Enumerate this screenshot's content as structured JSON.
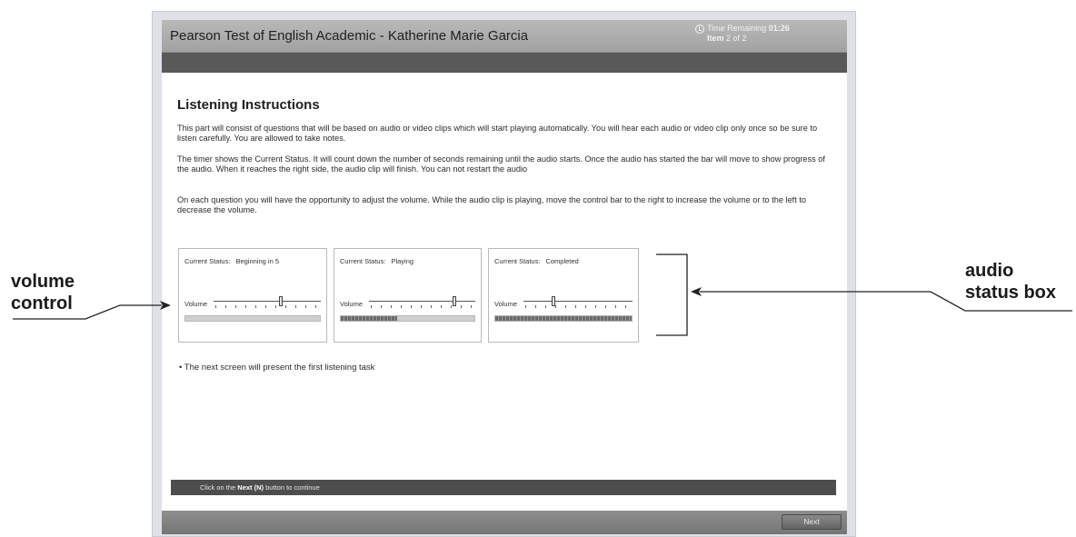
{
  "header": {
    "title": "Pearson Test of English Academic - Katherine Marie Garcia",
    "time_remaining_label": "Time Remaining",
    "time_remaining_value": "01:26",
    "item_label": "Item",
    "item_value": "2 of 2"
  },
  "main": {
    "heading": "Listening Instructions",
    "paragraphs": [
      "This part will consist of questions that will be based on audio or video clips which will start playing automatically. You will hear each audio or video clip only once so be sure to listen carefully. You are allowed to take notes.",
      "The timer shows the Current Status. It will count down the number of seconds remaining until the audio starts. Once the audio has started the bar will move to show progress of the audio. When it reaches the right side, the audio clip will finish. You can not restart the audio",
      "On each question you will have the opportunity to adjust the volume. While the audio clip is playing, move the control bar to the right to increase the volume or to the left to decrease the volume."
    ],
    "status_boxes": [
      {
        "status_label": "Current Status:",
        "status_value": "Beginning in 5",
        "volume_label": "Volume",
        "volume_level": 0.63,
        "progress": 0.0
      },
      {
        "status_label": "Current Status:",
        "status_value": "Playing",
        "volume_label": "Volume",
        "volume_level": 0.81,
        "progress": 0.42
      },
      {
        "status_label": "Current Status:",
        "status_value": "Completed",
        "volume_label": "Volume",
        "volume_level": 0.27,
        "progress": 1.0
      }
    ],
    "bullet": "• The next screen will present the first listening task"
  },
  "footer": {
    "instruction_prefix": "Click on the",
    "instruction_key": "Next (N)",
    "instruction_suffix": "button to continue",
    "next_button": "Next"
  },
  "annotations": {
    "volume_line1": "volume",
    "volume_line2": "control",
    "audio_line1": "audio",
    "audio_line2": "status box"
  }
}
